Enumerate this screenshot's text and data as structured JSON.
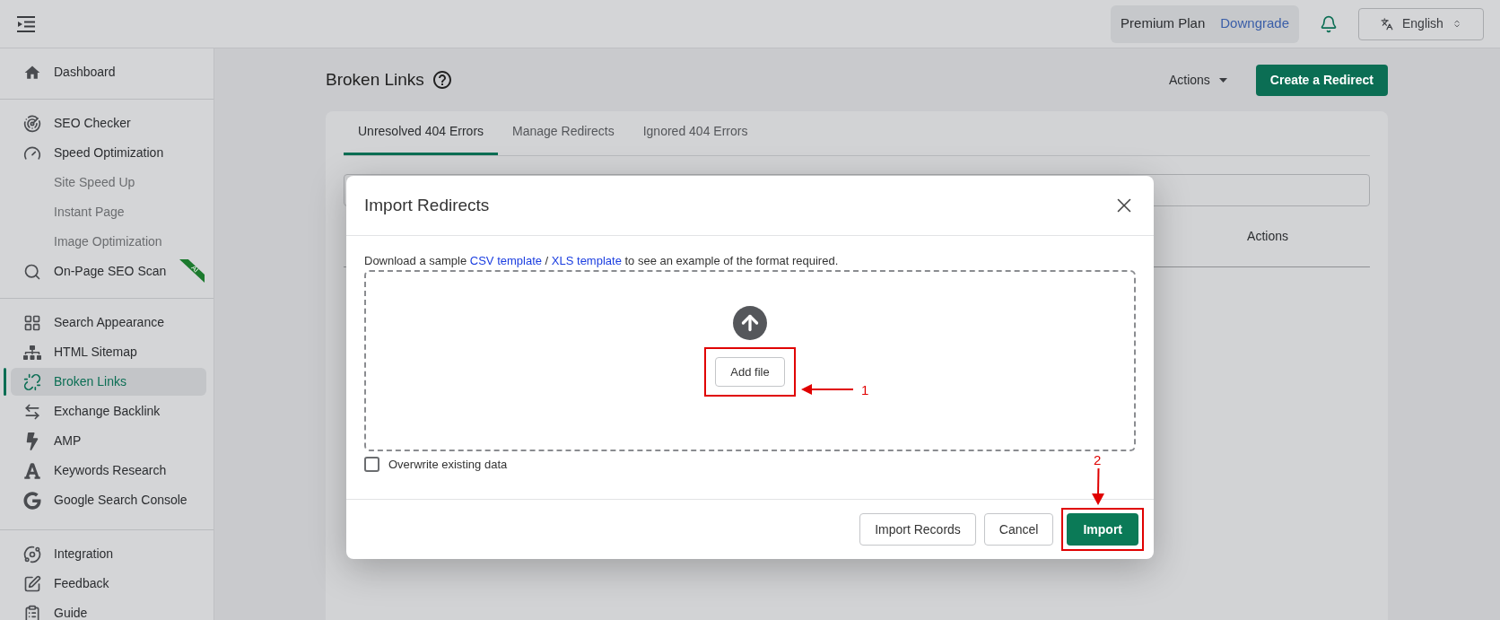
{
  "topbar": {
    "plan_label": "Premium Plan",
    "plan_action": "Downgrade",
    "language": "English"
  },
  "sidebar": {
    "groups": [
      [
        {
          "label": "Dashboard",
          "kind": "main",
          "selected": false
        }
      ],
      [
        {
          "label": "SEO Checker",
          "kind": "main",
          "selected": false
        },
        {
          "label": "Speed Optimization",
          "kind": "main",
          "selected": false
        },
        {
          "label": "Site Speed Up",
          "kind": "sub",
          "selected": false
        },
        {
          "label": "Instant Page",
          "kind": "sub",
          "selected": false
        },
        {
          "label": "Image Optimization",
          "kind": "sub",
          "selected": false
        },
        {
          "label": "On-Page SEO Scan",
          "kind": "main",
          "selected": false,
          "badge": "AI"
        }
      ],
      [
        {
          "label": "Search Appearance",
          "kind": "main",
          "selected": false
        },
        {
          "label": "HTML Sitemap",
          "kind": "main",
          "selected": false
        },
        {
          "label": "Broken Links",
          "kind": "main",
          "selected": true
        },
        {
          "label": "Exchange Backlink",
          "kind": "main",
          "selected": false
        },
        {
          "label": "AMP",
          "kind": "main",
          "selected": false
        },
        {
          "label": "Keywords Research",
          "kind": "main",
          "selected": false
        },
        {
          "label": "Google Search Console",
          "kind": "main",
          "selected": false
        }
      ],
      [
        {
          "label": "Integration",
          "kind": "main",
          "selected": false
        },
        {
          "label": "Feedback",
          "kind": "main",
          "selected": false
        },
        {
          "label": "Guide",
          "kind": "main",
          "selected": false
        }
      ]
    ]
  },
  "page": {
    "title": "Broken Links",
    "actions_menu": "Actions",
    "create_button": "Create a Redirect",
    "tabs": [
      {
        "label": "Unresolved 404 Errors",
        "selected": true
      },
      {
        "label": "Manage Redirects",
        "selected": false
      },
      {
        "label": "Ignored 404 Errors",
        "selected": false
      }
    ],
    "table_header": "Actions"
  },
  "modal": {
    "title": "Import Redirects",
    "description": [
      {
        "kind": "text",
        "text": "Download a sample "
      },
      {
        "kind": "link",
        "text": "CSV template"
      },
      {
        "kind": "text",
        "text": " / "
      },
      {
        "kind": "link",
        "text": "XLS template"
      },
      {
        "kind": "text",
        "text": " to see an example of the format required."
      }
    ],
    "add_file": "Add file",
    "overwrite": {
      "label": "Overwrite existing data",
      "checked": false
    },
    "buttons": [
      {
        "label": "Import Records",
        "kind": "secondary"
      },
      {
        "label": "Cancel",
        "kind": "secondary"
      },
      {
        "label": "Import",
        "kind": "primary"
      }
    ]
  },
  "annotations": [
    {
      "label": "1"
    },
    {
      "label": "2"
    }
  ]
}
